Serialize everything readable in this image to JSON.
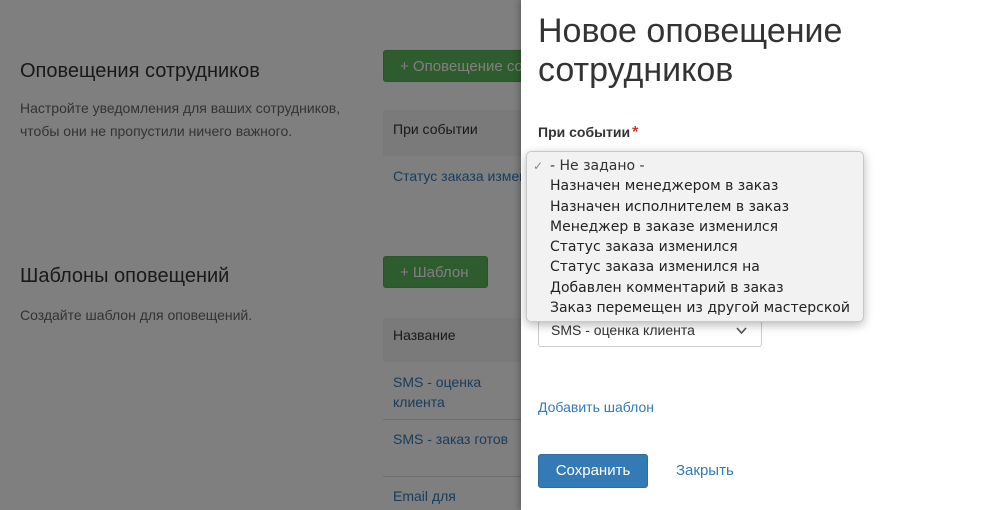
{
  "background": {
    "employee_notifications": {
      "title": "Оповещения сотрудников",
      "description": "Настройте уведомления для ваших сотрудников, чтобы они не пропустили ничего важного.",
      "add_button": "+ Оповещение со",
      "table_header": "При событии",
      "rows": [
        "Статус заказа измен"
      ]
    },
    "templates": {
      "title": "Шаблоны оповещений",
      "description": "Создайте шаблон для оповещений.",
      "add_button": "+ Шаблон",
      "table_header": "Название",
      "rows": [
        "SMS - оценка клиента",
        "SMS - заказ готов",
        "Email для"
      ]
    }
  },
  "modal": {
    "title": "Новое оповещение сотрудников",
    "event_label": "При событии",
    "required_mark": "*",
    "event_options": [
      "- Не задано -",
      "Назначен менеджером в заказ",
      "Назначен исполнителем в заказ",
      "Менеджер в заказе изменился",
      "Статус заказа изменился",
      "Статус заказа изменился на",
      "Добавлен комментарий в заказ",
      "Заказ перемещен из другой мастерской"
    ],
    "event_selected_mark": "✓",
    "template_select_value": "SMS - оценка клиента",
    "add_template_link": "Добавить шаблон",
    "save_button": "Сохранить",
    "close_link": "Закрыть"
  },
  "colors": {
    "primary": "#337ab7",
    "success": "#5cb85c",
    "required": "#d9312b"
  }
}
